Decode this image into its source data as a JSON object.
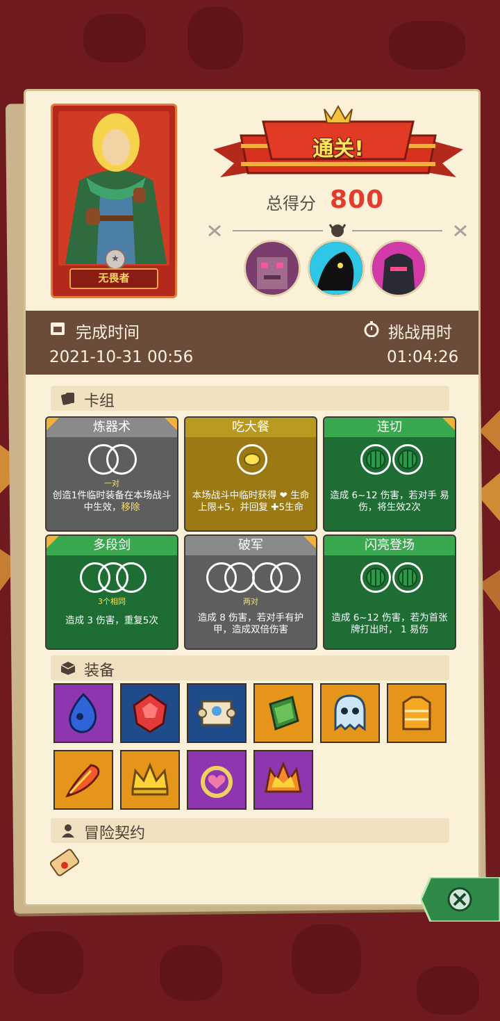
{
  "result": {
    "banner": "通关!",
    "score_label": "总得分",
    "score_value": "800"
  },
  "hero": {
    "name": "无畏者",
    "portrait": "hero-portrait"
  },
  "bosses": [
    {
      "icon": "boss-stone-golem"
    },
    {
      "icon": "boss-shadow-beast"
    },
    {
      "icon": "boss-dark-knight"
    }
  ],
  "stats": {
    "finish_label": "完成时间",
    "finish_value": "2021-10-31 00:56",
    "duration_label": "挑战用时",
    "duration_value": "01:04:26"
  },
  "deck": {
    "title": "卡组",
    "cards": [
      {
        "name": "炼器术",
        "color": "gray",
        "slot_hint": "一对",
        "desc": "创造1件临时装备在本场战斗中生效，",
        "desc_tail": "移除"
      },
      {
        "name": "吃大餐",
        "color": "gold",
        "slot_hint": "",
        "desc": "本场战斗中临时获得 ❤ 生命上限+5，并回复 ✚5生命",
        "desc_tail": ""
      },
      {
        "name": "连切",
        "color": "green",
        "slot_hint": "",
        "desc": "造成 6~12 伤害，若对手 易伤，将生效2次",
        "desc_tail": ""
      },
      {
        "name": "多段剑",
        "color": "green",
        "slot_hint": "3个相同",
        "desc": "造成 3 伤害，重复5次",
        "desc_tail": ""
      },
      {
        "name": "破军",
        "color": "gray",
        "slot_hint": "两对",
        "desc": "造成 8 伤害，若对手有护甲，造成双倍伤害",
        "desc_tail": ""
      },
      {
        "name": "闪亮登场",
        "color": "green",
        "slot_hint": "",
        "desc": "造成 6~12 伤害，若为首张牌打出时， 1 易伤",
        "desc_tail": ""
      }
    ]
  },
  "equipment": {
    "title": "装备",
    "items": [
      {
        "icon": "blue-flame-icon",
        "color": "purple"
      },
      {
        "icon": "red-gem-icon",
        "color": "blue"
      },
      {
        "icon": "scroll-icon",
        "color": "blue"
      },
      {
        "icon": "green-book-icon",
        "color": "orange"
      },
      {
        "icon": "ghost-slime-icon",
        "color": "orange"
      },
      {
        "icon": "knit-sweater-icon",
        "color": "orange"
      },
      {
        "icon": "fire-feather-icon",
        "color": "orange"
      },
      {
        "icon": "gold-crown-icon",
        "color": "orange"
      },
      {
        "icon": "heart-wreath-icon",
        "color": "purple"
      },
      {
        "icon": "flame-crown-icon",
        "color": "purple"
      }
    ]
  },
  "contract": {
    "title": "冒险契约",
    "item_icon": "contract-scroll-icon"
  },
  "colors": {
    "accent_red": "#e53a2e",
    "band_brown": "#6b4c3b",
    "paper": "#fbf1d8"
  }
}
